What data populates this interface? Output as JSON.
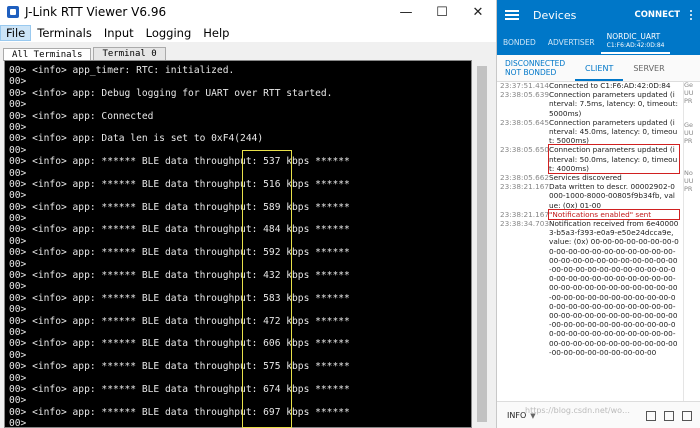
{
  "window": {
    "title": "J-Link RTT Viewer V6.96",
    "minimize": "—",
    "maximize": "☐",
    "close": "✕"
  },
  "menu": [
    "File",
    "Terminals",
    "Input",
    "Logging",
    "Help"
  ],
  "tabs": [
    "All Terminals",
    "Terminal 0"
  ],
  "terminal_lines": [
    "00> <info> app_timer: RTC: initialized.",
    "00>",
    "00> <info> app: Debug logging for UART over RTT started.",
    "00>",
    "00> <info> app: Connected",
    "00>",
    "00> <info> app: Data len is set to 0xF4(244)",
    "00>",
    "00> <info> app: ****** BLE data throughput: 537 kbps ******",
    "00>",
    "00> <info> app: ****** BLE data throughput: 516 kbps ******",
    "00>",
    "00> <info> app: ****** BLE data throughput: 589 kbps ******",
    "00>",
    "00> <info> app: ****** BLE data throughput: 484 kbps ******",
    "00>",
    "00> <info> app: ****** BLE data throughput: 592 kbps ******",
    "00>",
    "00> <info> app: ****** BLE data throughput: 432 kbps ******",
    "00>",
    "00> <info> app: ****** BLE data throughput: 583 kbps ******",
    "00>",
    "00> <info> app: ****** BLE data throughput: 472 kbps ******",
    "00>",
    "00> <info> app: ****** BLE data throughput: 606 kbps ******",
    "00>",
    "00> <info> app: ****** BLE data throughput: 575 kbps ******",
    "00>",
    "00> <info> app: ****** BLE data throughput: 674 kbps ******",
    "00>",
    "00> <info> app: ****** BLE data throughput: 697 kbps ******",
    "00>"
  ],
  "phone": {
    "app_title": "Devices",
    "connect": "CONNECT",
    "tabs": [
      "BONDED",
      "ADVERTISER"
    ],
    "device_name": "NORDIC_UART",
    "device_addr": "C1:F6:AD:42:0D:84",
    "status_line1": "DISCONNECTED",
    "status_line2": "NOT BONDED",
    "client_tab": "CLIENT",
    "server_tab": "SERVER",
    "log": [
      {
        "ts": "23:37:51.414",
        "msg": "Connected to C1:F6:AD:42:0D:84"
      },
      {
        "ts": "23:38:05.639",
        "msg": "Connection parameters updated (interval: 7.5ms, latency: 0, timeout: 5000ms)"
      },
      {
        "ts": "23:38:05.645",
        "msg": "Connection parameters updated (interval: 45.0ms, latency: 0, timeout: 5000ms)"
      },
      {
        "ts": "23:38:05.650",
        "msg": "Connection parameters updated (interval: 50.0ms, latency: 0, timeout: 4000ms)"
      },
      {
        "ts": "23:38:05.662",
        "msg": "Services discovered"
      },
      {
        "ts": "23:38:21.167",
        "msg": "Data written to descr. 00002902-0000-1000-8000-00805f9b34fb, value: (0x) 01-00"
      },
      {
        "ts": "23:38:21.167",
        "msg": "\"Notifications enabled\" sent"
      },
      {
        "ts": "23:38:34.703",
        "msg": "Notification received from 6e400003-b5a3-f393-e0a9-e50e24dcca9e, value: (0x) 00-00-00-00-00-00-00-00-00-00-00-00-00-00-00-00-00-00-00-00-00-00-00-00-00-00-00-00-00-00-00-00-00-00-00-00-00-00-00-00-00-00-00-00-00-00-00-00-00-00-00-00-00-00-00-00-00-00-00-00-00-00-00-00-00-00-00-00-00-00-00-00-00-00-00-00-00-00-00-00-00-00-00-00-00-00-00-00-00-00-00-00-00-00-00-00-00-00-00-00-00-00-00-00-00-00-00-00-00-00-00-00-00-00-00-00-00-00-00-00-00-00-00-00-00-00-00-00-00-00-00-00-00-00"
      }
    ],
    "side_text": [
      "Ge",
      "UU",
      "PR",
      "",
      "",
      "Ge",
      "UU",
      "PR",
      "",
      "",
      "",
      "No",
      "UU",
      "PR"
    ],
    "log_level": "INFO",
    "watermark": "https://blog.csdn.net/wo…"
  }
}
